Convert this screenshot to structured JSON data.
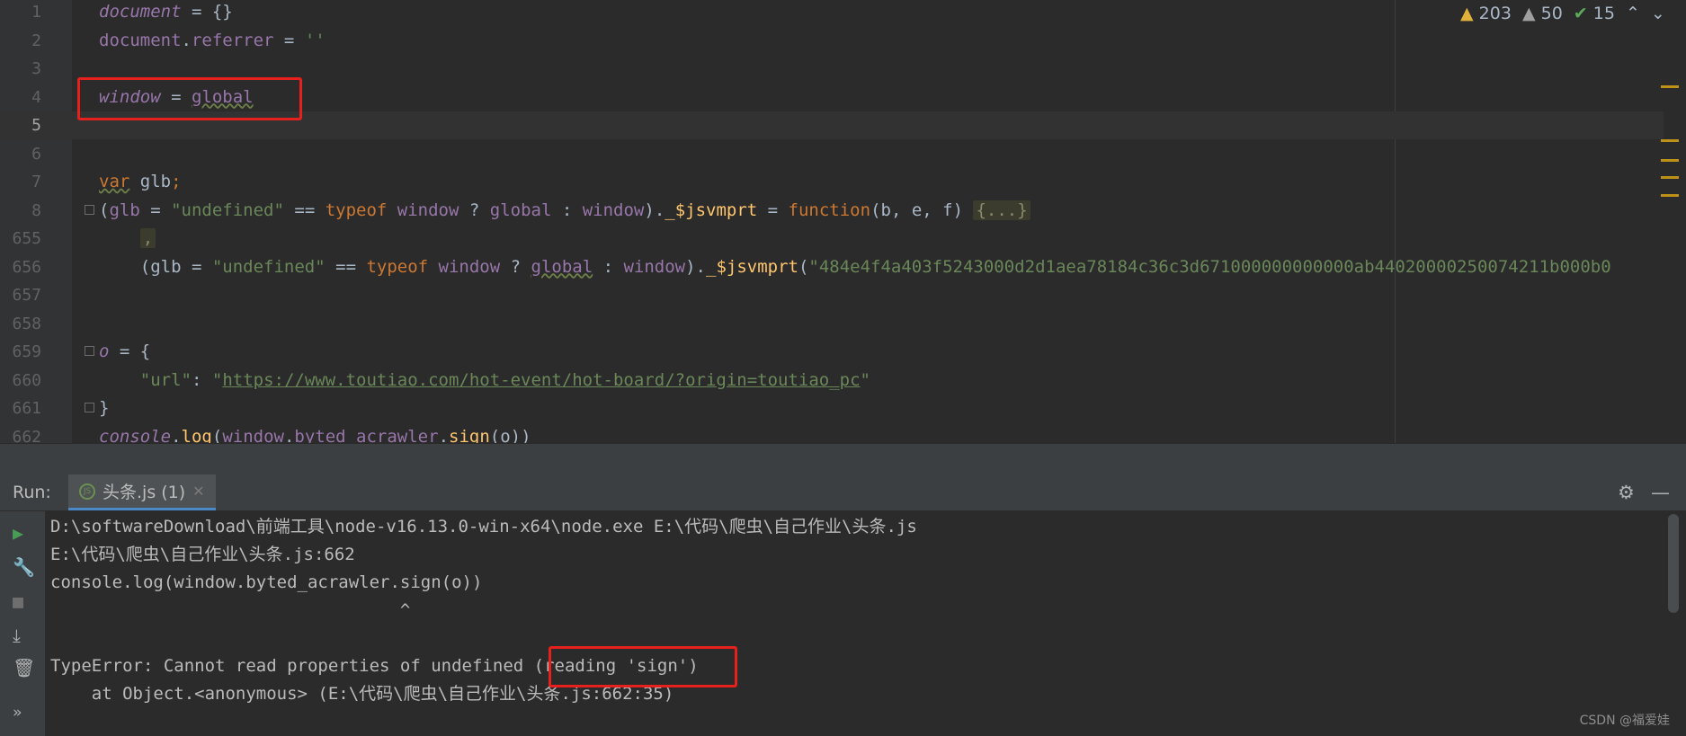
{
  "editor": {
    "lines": [
      {
        "num": "1",
        "segments": [
          {
            "t": "document",
            "c": "pv"
          },
          {
            "t": " = {}",
            "c": "plain"
          }
        ]
      },
      {
        "num": "2",
        "segments": [
          {
            "t": "document",
            "c": "prop"
          },
          {
            "t": ".",
            "c": "plain"
          },
          {
            "t": "referrer",
            "c": "prop"
          },
          {
            "t": " = ",
            "c": "plain"
          },
          {
            "t": "''",
            "c": "str"
          }
        ]
      },
      {
        "num": "3",
        "segments": []
      },
      {
        "num": "4",
        "segments": [
          {
            "t": "window",
            "c": "pv"
          },
          {
            "t": " = ",
            "c": "plain"
          },
          {
            "t": "global",
            "c": "prop wavy"
          }
        ]
      },
      {
        "num": "5",
        "segments": []
      },
      {
        "num": "6",
        "segments": []
      },
      {
        "num": "7",
        "segments": [
          {
            "t": "var",
            "c": "kw wavy"
          },
          {
            "t": " glb",
            "c": "plain"
          },
          {
            "t": ";",
            "c": "kw"
          }
        ]
      },
      {
        "num": "8",
        "segments": [
          {
            "t": "(",
            "c": "plain"
          },
          {
            "t": "glb",
            "c": "prop"
          },
          {
            "t": " = ",
            "c": "plain"
          },
          {
            "t": "\"undefined\"",
            "c": "str"
          },
          {
            "t": " == ",
            "c": "plain"
          },
          {
            "t": "typeof",
            "c": "kw"
          },
          {
            "t": " window",
            "c": "prop"
          },
          {
            "t": " ? ",
            "c": "plain"
          },
          {
            "t": "global",
            "c": "prop"
          },
          {
            "t": " : ",
            "c": "plain"
          },
          {
            "t": "window",
            "c": "prop"
          },
          {
            "t": ").",
            "c": "plain"
          },
          {
            "t": "_$jsvmprt",
            "c": "fn"
          },
          {
            "t": " = ",
            "c": "plain"
          },
          {
            "t": "function",
            "c": "kw"
          },
          {
            "t": "(b, e, f) ",
            "c": "plain"
          },
          {
            "t": "{...}",
            "c": "folded"
          }
        ]
      },
      {
        "num": "655",
        "segments": [
          {
            "t": "    ",
            "c": "plain"
          },
          {
            "t": ",",
            "c": "kw folded"
          }
        ]
      },
      {
        "num": "656",
        "segments": [
          {
            "t": "    (glb = ",
            "c": "plain"
          },
          {
            "t": "\"undefined\"",
            "c": "str"
          },
          {
            "t": " == ",
            "c": "plain"
          },
          {
            "t": "typeof",
            "c": "kw"
          },
          {
            "t": " window",
            "c": "prop"
          },
          {
            "t": " ? ",
            "c": "plain"
          },
          {
            "t": "global",
            "c": "prop wavy"
          },
          {
            "t": " : ",
            "c": "plain"
          },
          {
            "t": "window",
            "c": "prop"
          },
          {
            "t": ").",
            "c": "plain"
          },
          {
            "t": "_$jsvmprt",
            "c": "fn"
          },
          {
            "t": "(",
            "c": "plain"
          },
          {
            "t": "\"484e4f4a403f5243000d2d1aea78184c36c3d671000000000000ab44020000250074211b000b0",
            "c": "str"
          }
        ]
      },
      {
        "num": "657",
        "segments": []
      },
      {
        "num": "658",
        "segments": []
      },
      {
        "num": "659",
        "segments": [
          {
            "t": "o",
            "c": "pv"
          },
          {
            "t": " = {",
            "c": "plain"
          }
        ]
      },
      {
        "num": "660",
        "segments": [
          {
            "t": "    ",
            "c": "plain"
          },
          {
            "t": "\"url\"",
            "c": "str"
          },
          {
            "t": ": ",
            "c": "plain"
          },
          {
            "t": "\"",
            "c": "str"
          },
          {
            "t": "https://www.toutiao.com/hot-event/hot-board/?origin=toutiao_pc",
            "c": "link"
          },
          {
            "t": "\"",
            "c": "str"
          }
        ]
      },
      {
        "num": "661",
        "segments": [
          {
            "t": "}",
            "c": "plain"
          }
        ]
      },
      {
        "num": "662",
        "segments": [
          {
            "t": "console",
            "c": "pv"
          },
          {
            "t": ".",
            "c": "plain"
          },
          {
            "t": "log",
            "c": "fn"
          },
          {
            "t": "(",
            "c": "plain"
          },
          {
            "t": "window",
            "c": "prop"
          },
          {
            "t": ".",
            "c": "plain"
          },
          {
            "t": "byted_acrawler",
            "c": "prop"
          },
          {
            "t": ".",
            "c": "plain"
          },
          {
            "t": "sign",
            "c": "fn"
          },
          {
            "t": "(o))",
            "c": "plain"
          }
        ]
      }
    ],
    "inspections": {
      "warnings": "203",
      "weak_warnings": "50",
      "typos": "15"
    }
  },
  "run_panel": {
    "label": "Run:",
    "tab_label": "头条.js (1)",
    "tab_icon": "js-file-icon",
    "output": [
      "D:\\softwareDownload\\前端工具\\node-v16.13.0-win-x64\\node.exe E:\\代码\\爬虫\\自己作业\\头条.js",
      "E:\\代码\\爬虫\\自己作业\\头条.js:662",
      "console.log(window.byted_acrawler.sign(o))",
      "                                  ^",
      "",
      "TypeError: Cannot read properties of undefined (reading 'sign')",
      "    at Object.<anonymous> (E:\\代码\\爬虫\\自己作业\\头条.js:662:35)"
    ]
  },
  "watermark": "CSDN @福爱娃",
  "colors": {
    "highlight_box": "#e5201d",
    "keyword": "#cc7832",
    "string": "#6a8759",
    "property": "#9876aa",
    "function": "#ffc66d"
  }
}
